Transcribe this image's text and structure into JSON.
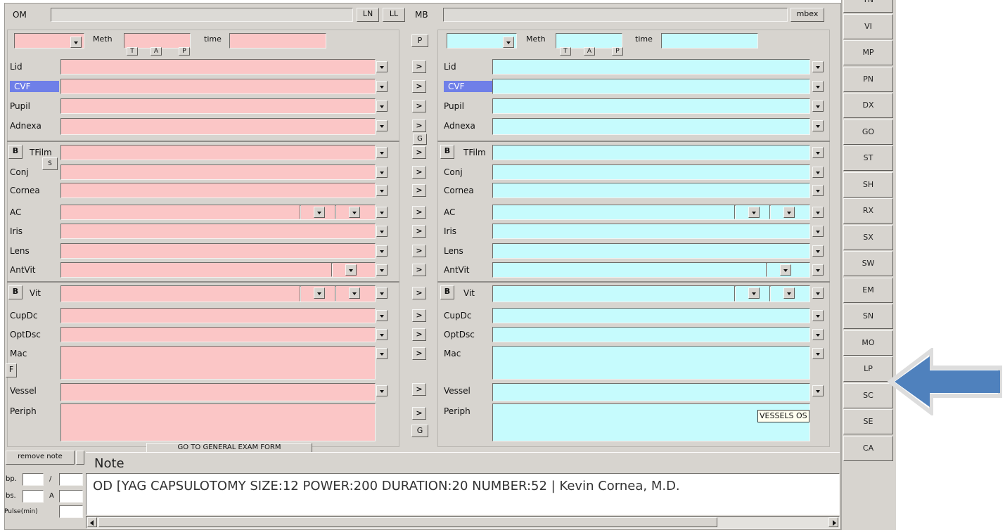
{
  "top": {
    "om_label": "OM",
    "ln": "LN",
    "ll": "LL",
    "mb_label": "MB",
    "mbex": "mbex"
  },
  "od": {
    "meth": "Meth",
    "time": "time",
    "t": "T",
    "a": "A",
    "p": "P",
    "b": "B",
    "s": "S",
    "f": "F",
    "fields": {
      "lid": "Lid",
      "cvf": "CVF",
      "pupil": "Pupil",
      "adnexa": "Adnexa",
      "tfilm": "TFilm",
      "conj": "Conj",
      "cornea": "Cornea",
      "ac": "AC",
      "iris": "Iris",
      "lens": "Lens",
      "antvit": "AntVit",
      "vit": "Vit",
      "cupdc": "CupDc",
      "optdsc": "OptDsc",
      "mac": "Mac",
      "vessel": "Vessel",
      "periph": "Periph"
    }
  },
  "os": {
    "meth": "Meth",
    "time": "time",
    "t": "T",
    "a": "A",
    "p": "P",
    "b": "B",
    "fields": {
      "lid": "Lid",
      "cvf": "CVF",
      "pupil": "Pupil",
      "adnexa": "Adnexa",
      "tfilm": "TFilm",
      "conj": "Conj",
      "cornea": "Cornea",
      "ac": "AC",
      "iris": "Iris",
      "lens": "Lens",
      "antvit": "AntVit",
      "vit": "Vit",
      "cupdc": "CupDc",
      "optdsc": "OptDsc",
      "mac": "Mac",
      "vessel": "Vessel",
      "periph": "Periph"
    },
    "tooltip": "VESSELS OS"
  },
  "middle": {
    "p_button": "P",
    "g_button": "G",
    "copy_arrow": ">"
  },
  "footer": {
    "go_general": "GO TO GENERAL EXAM FORM",
    "remove_note": "remove note",
    "note_title": "Note",
    "note_text": "OD [YAG CAPSULOTOMY SIZE:12 POWER:200 DURATION:20 NUMBER:52 | Kevin Cornea, M.D.",
    "bp_label": "bp.",
    "slash": "/",
    "bs_label": "bs.",
    "a_label": "A",
    "pulse_label": "Pulse(min)"
  },
  "sidebar": [
    "TN",
    "VI",
    "MP",
    "PN",
    "DX",
    "GO",
    "ST",
    "SH",
    "RX",
    "SX",
    "SW",
    "EM",
    "SN",
    "MO",
    "LP",
    "SC",
    "SE",
    "CA"
  ],
  "colors": {
    "od_field": "#fbc6c6",
    "os_field": "#c6fbfd",
    "selected_label": "#6f7fe8",
    "callout_arrow": "#4f81bd"
  },
  "icons": {
    "dropdown": "chevron-down-icon",
    "copy": "arrow-right-icon",
    "callout": "left-arrow-icon"
  }
}
